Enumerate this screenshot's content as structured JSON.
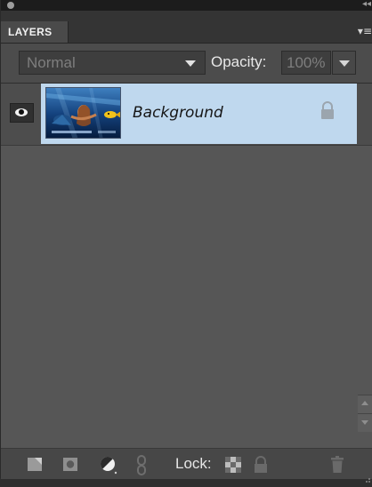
{
  "panel": {
    "tab_label": "LAYERS",
    "menu_icon": "panel-menu-icon",
    "collapse_icon": "collapse-arrows-icon"
  },
  "options": {
    "blend_mode": "Normal",
    "opacity_label": "Opacity:",
    "opacity_value": "100%"
  },
  "layers": [
    {
      "name": "Background",
      "visible": true,
      "locked": true,
      "selected": true
    }
  ],
  "toolbar": {
    "lock_label": "Lock:",
    "buttons": [
      "new-layer-icon",
      "layer-mask-icon",
      "adjustment-layer-icon",
      "link-layers-icon",
      "lock-transparent-pixels-icon",
      "lock-all-icon",
      "delete-layer-icon"
    ]
  },
  "colors": {
    "selected_row": "#bfd8ee",
    "panel_bg": "#565656"
  }
}
